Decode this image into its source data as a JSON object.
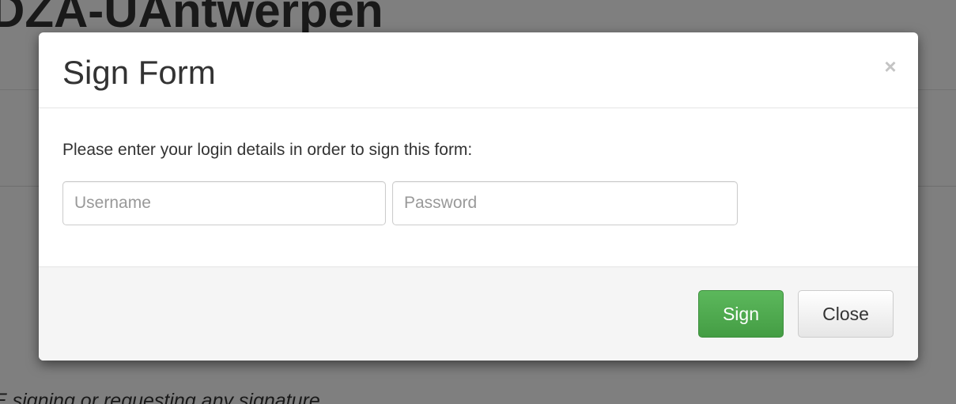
{
  "background": {
    "title": "DZA-UAntwerpen",
    "note": "E signing or requesting any signature"
  },
  "modal": {
    "title": "Sign Form",
    "close_glyph": "×",
    "instruction": "Please enter your login details in order to sign this form:",
    "username_placeholder": "Username",
    "username_value": "",
    "password_placeholder": "Password",
    "password_value": "",
    "sign_label": "Sign",
    "close_label": "Close"
  },
  "colors": {
    "backdrop": "rgba(0,0,0,0.5)",
    "sign_button": "#5cb85c",
    "footer_background": "#f5f5f5"
  },
  "icons": {
    "dismiss": "close-icon"
  }
}
